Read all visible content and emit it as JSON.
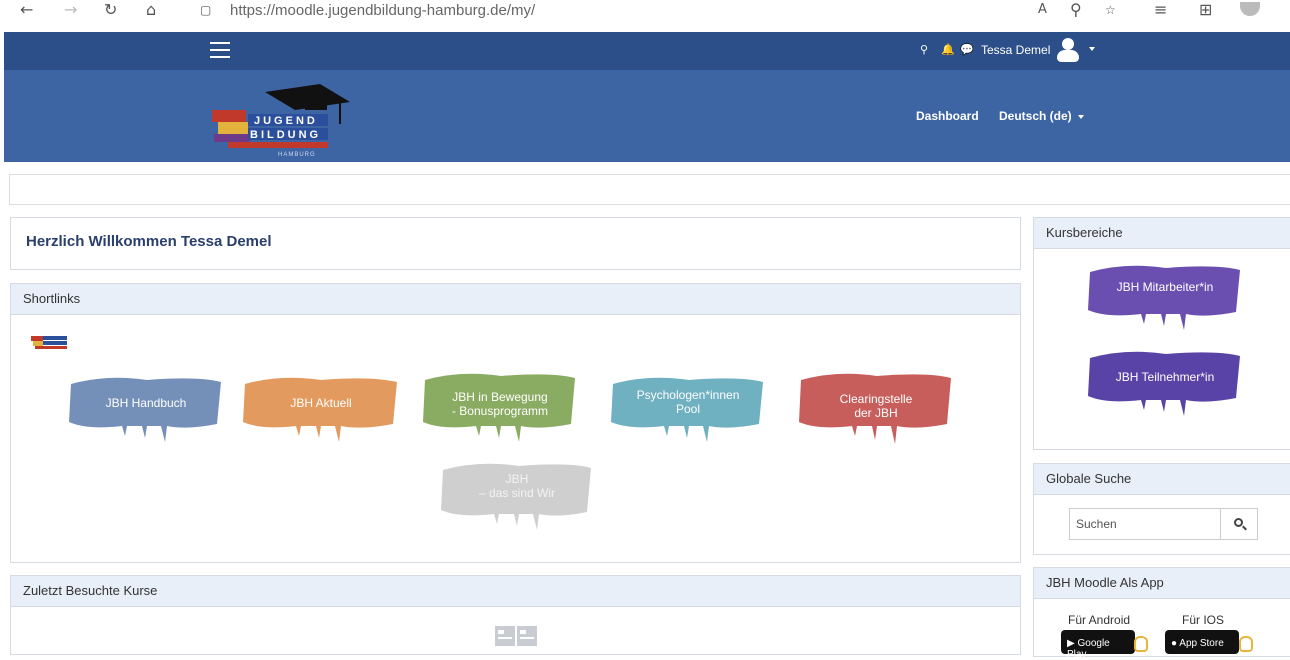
{
  "browser": {
    "url": "https://moodle.jugendbildung-hamburg.de/my/"
  },
  "topnav": {
    "username": "Tessa Demel"
  },
  "header": {
    "nav": [
      "Dashboard",
      "Deutsch (de)"
    ]
  },
  "welcome": {
    "heading": "Herzlich Willkommen Tessa Demel"
  },
  "shortlinks": {
    "title": "Shortlinks",
    "items": [
      {
        "label": "JBH Handbuch",
        "color": "#7590b8"
      },
      {
        "label": "JBH Aktuell",
        "color": "#e39a5f"
      },
      {
        "label": "JBH in Bewegung\n- Bonusprogramm",
        "color": "#8aab62"
      },
      {
        "label": "Psychologen*innen\nPool",
        "color": "#6fb0c1"
      },
      {
        "label": "Clearingstelle\nder JBH",
        "color": "#c85e5b"
      },
      {
        "label": "JBH\n– das sind Wir",
        "color": "#cfcfcf"
      }
    ]
  },
  "recent": {
    "title": "Zuletzt Besuchte Kurse"
  },
  "kursbereiche": {
    "title": "Kursbereiche",
    "items": [
      {
        "label": "JBH Mitarbeiter*in",
        "color": "#6a4fb0"
      },
      {
        "label": "JBH Teilnehmer*in",
        "color": "#5a43a6"
      }
    ]
  },
  "suche": {
    "title": "Globale Suche",
    "placeholder": "Suchen"
  },
  "app": {
    "title": "JBH Moodle Als App",
    "android_label": "Für Android",
    "ios_label": "Für IOS",
    "google_badge": "Google Play",
    "apple_badge": "App Store"
  }
}
